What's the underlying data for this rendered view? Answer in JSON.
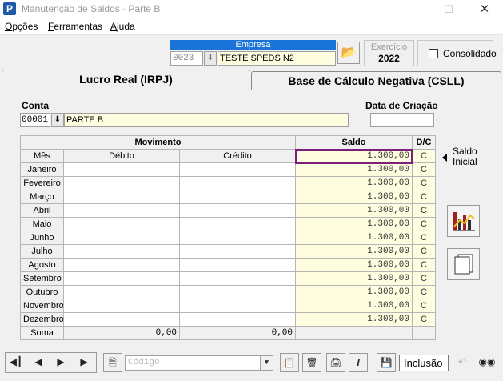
{
  "window": {
    "title": "Manutenção de Saldos - Parte B",
    "icon_letter": "P"
  },
  "menu": [
    {
      "label": "Opções",
      "accel": "O"
    },
    {
      "label": "Ferramentas",
      "accel": "F"
    },
    {
      "label": "Ajuda",
      "accel": "A"
    }
  ],
  "empresa": {
    "header": "Empresa",
    "code": "0023",
    "name": "TESTE SPEDS N2"
  },
  "exercicio": {
    "label": "Exercício",
    "year": "2022"
  },
  "consolidado": {
    "label": "Consolidado",
    "checked": false
  },
  "tabs": [
    {
      "label": "Lucro Real (IRPJ)",
      "active": true
    },
    {
      "label": "Base de Cálculo Negativa (CSLL)",
      "active": false
    }
  ],
  "conta": {
    "label": "Conta",
    "code": "00001",
    "name": "PARTE B"
  },
  "data_criacao": {
    "label": "Data de Criação",
    "value": ""
  },
  "grid": {
    "header_movimento": "Movimento",
    "header_saldo": "Saldo",
    "header_dc": "D/C",
    "col_mes": "Mês",
    "col_debito": "Débito",
    "col_credito": "Crédito",
    "saldo_inicial": {
      "value": "1.300,00",
      "dc": "C"
    },
    "rows": [
      {
        "mes": "Janeiro",
        "debito": "",
        "credito": "",
        "saldo": "1.300,00",
        "dc": "C"
      },
      {
        "mes": "Fevereiro",
        "debito": "",
        "credito": "",
        "saldo": "1.300,00",
        "dc": "C"
      },
      {
        "mes": "Março",
        "debito": "",
        "credito": "",
        "saldo": "1.300,00",
        "dc": "C"
      },
      {
        "mes": "Abril",
        "debito": "",
        "credito": "",
        "saldo": "1.300,00",
        "dc": "C"
      },
      {
        "mes": "Maio",
        "debito": "",
        "credito": "",
        "saldo": "1.300,00",
        "dc": "C"
      },
      {
        "mes": "Junho",
        "debito": "",
        "credito": "",
        "saldo": "1.300,00",
        "dc": "C"
      },
      {
        "mes": "Julho",
        "debito": "",
        "credito": "",
        "saldo": "1.300,00",
        "dc": "C"
      },
      {
        "mes": "Agosto",
        "debito": "",
        "credito": "",
        "saldo": "1.300,00",
        "dc": "C"
      },
      {
        "mes": "Setembro",
        "debito": "",
        "credito": "",
        "saldo": "1.300,00",
        "dc": "C"
      },
      {
        "mes": "Outubro",
        "debito": "",
        "credito": "",
        "saldo": "1.300,00",
        "dc": "C"
      },
      {
        "mes": "Novembro",
        "debito": "",
        "credito": "",
        "saldo": "1.300,00",
        "dc": "C"
      },
      {
        "mes": "Dezembro",
        "debito": "",
        "credito": "",
        "saldo": "1.300,00",
        "dc": "C"
      }
    ],
    "soma": {
      "label": "Soma",
      "debito": "0,00",
      "credito": "0,00"
    }
  },
  "saldo_inicial_label": {
    "line1": "Saldo",
    "line2": "Inicial"
  },
  "toolbar": {
    "codigo_placeholder": "Código",
    "mode": "Inclusão"
  },
  "colors": {
    "selection_border": "#7b1f7a",
    "empresa_header": "#1a73d6",
    "input_yellow": "#fffde0"
  }
}
